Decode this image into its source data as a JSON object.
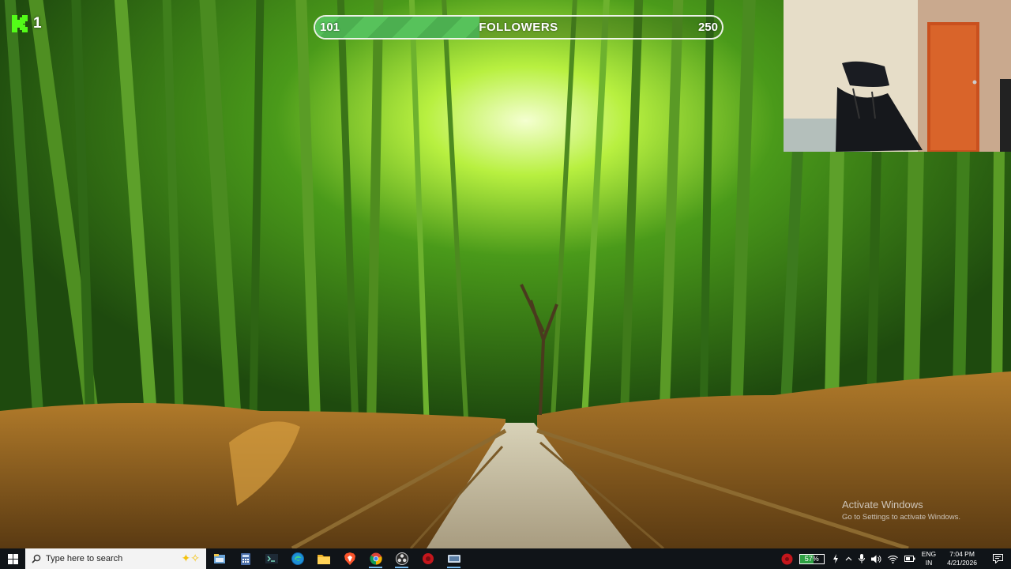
{
  "stream_overlay": {
    "viewer_count": "1",
    "follower_goal": {
      "current": "101",
      "label": "FOLLOWERS",
      "goal": "250",
      "progress_fraction": 0.404
    }
  },
  "watermark": {
    "line1": "Activate Windows",
    "line2": "Go to Settings to activate Windows."
  },
  "taskbar": {
    "search_placeholder": "Type here to search",
    "apps": [
      {
        "name": "file-explorer-icon"
      },
      {
        "name": "calculator-icon"
      },
      {
        "name": "terminal-icon"
      },
      {
        "name": "edge-browser-icon"
      },
      {
        "name": "folder-icon"
      },
      {
        "name": "brave-browser-icon"
      },
      {
        "name": "chrome-browser-icon"
      },
      {
        "name": "obs-studio-icon"
      },
      {
        "name": "red-app-icon"
      },
      {
        "name": "network-app-icon"
      }
    ],
    "tray": {
      "battery_percent": "57%",
      "battery_level": 0.57,
      "language_line1": "ENG",
      "language_line2": "IN",
      "time": "7:04 PM",
      "date": "4/21/2026"
    }
  },
  "colors": {
    "kick_green": "#53fc18",
    "taskbar": "#101418",
    "progress_green": "#57c25b"
  }
}
